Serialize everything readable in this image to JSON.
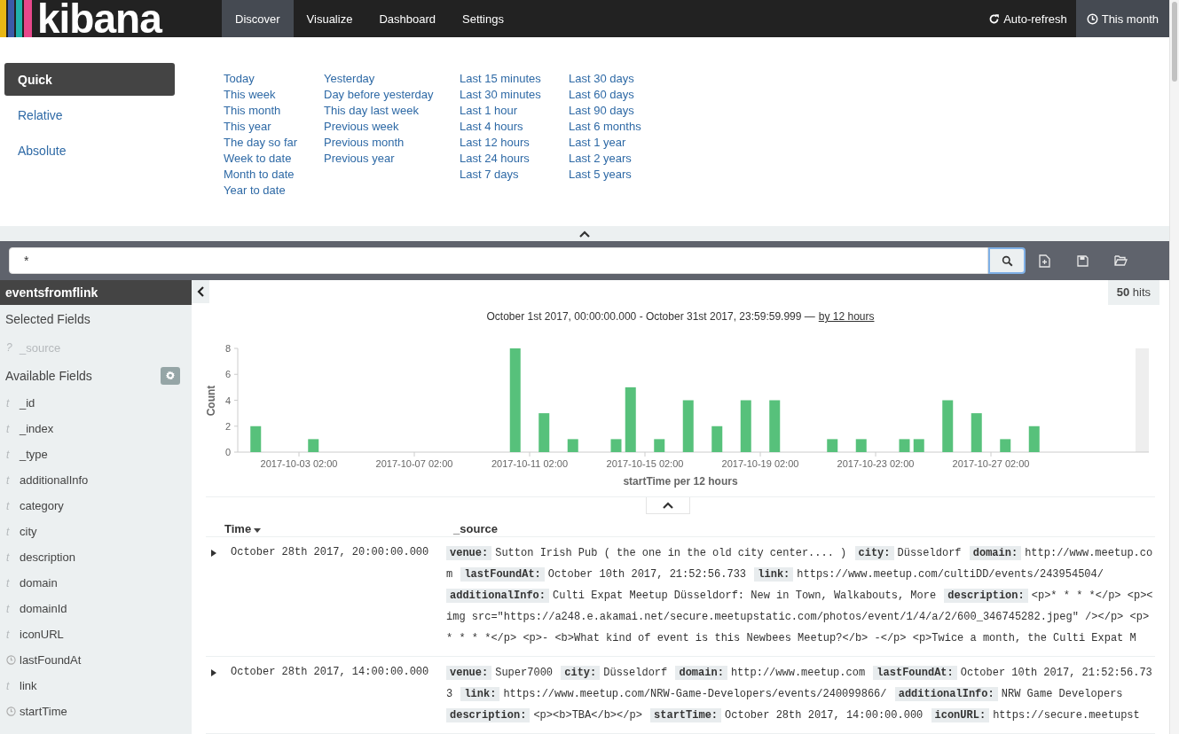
{
  "nav": {
    "logo": "kibana",
    "tabs": [
      {
        "label": "Discover",
        "selected": true
      },
      {
        "label": "Visualize",
        "selected": false
      },
      {
        "label": "Dashboard",
        "selected": false
      },
      {
        "label": "Settings",
        "selected": false
      }
    ],
    "auto_refresh": "Auto-refresh",
    "time_range": "This month"
  },
  "time_picker": {
    "modes": [
      {
        "label": "Quick",
        "selected": true
      },
      {
        "label": "Relative",
        "selected": false
      },
      {
        "label": "Absolute",
        "selected": false
      }
    ],
    "columns": [
      [
        "Today",
        "This week",
        "This month",
        "This year",
        "The day so far",
        "Week to date",
        "Month to date",
        "Year to date"
      ],
      [
        "Yesterday",
        "Day before yesterday",
        "This day last week",
        "Previous week",
        "Previous month",
        "Previous year"
      ],
      [
        "Last 15 minutes",
        "Last 30 minutes",
        "Last 1 hour",
        "Last 4 hours",
        "Last 12 hours",
        "Last 24 hours",
        "Last 7 days"
      ],
      [
        "Last 30 days",
        "Last 60 days",
        "Last 90 days",
        "Last 6 months",
        "Last 1 year",
        "Last 2 years",
        "Last 5 years"
      ]
    ]
  },
  "search": {
    "value": "*"
  },
  "sidebar": {
    "index_pattern": "eventsfromflink",
    "selected_heading": "Selected Fields",
    "selected_fields": [
      {
        "kind": "text",
        "icon": "?",
        "name": "_source"
      }
    ],
    "available_heading": "Available Fields",
    "available_fields": [
      {
        "kind": "text",
        "icon": "t",
        "name": "_id"
      },
      {
        "kind": "text",
        "icon": "t",
        "name": "_index"
      },
      {
        "kind": "text",
        "icon": "t",
        "name": "_type"
      },
      {
        "kind": "text",
        "icon": "t",
        "name": "additionalInfo"
      },
      {
        "kind": "text",
        "icon": "t",
        "name": "category"
      },
      {
        "kind": "text",
        "icon": "t",
        "name": "city"
      },
      {
        "kind": "text",
        "icon": "t",
        "name": "description"
      },
      {
        "kind": "text",
        "icon": "t",
        "name": "domain"
      },
      {
        "kind": "text",
        "icon": "t",
        "name": "domainId"
      },
      {
        "kind": "text",
        "icon": "t",
        "name": "iconURL"
      },
      {
        "kind": "date",
        "name": "lastFoundAt"
      },
      {
        "kind": "text",
        "icon": "t",
        "name": "link"
      },
      {
        "kind": "date",
        "name": "startTime"
      }
    ]
  },
  "main": {
    "hits": "**50** hits",
    "range": "October 1st 2017, 00:00:00.000 - October 31st 2017, 23:59:59.999 —",
    "interval_link": "by 12 hours",
    "chart_data": {
      "type": "bar",
      "xlabel": "startTime per 12 hours",
      "ylabel": "Count",
      "categories": [
        null,
        null,
        null,
        null,
        "2017-10-03 02:00",
        null,
        null,
        null,
        null,
        null,
        null,
        null,
        "2017-10-07 02:00",
        null,
        null,
        null,
        null,
        null,
        null,
        null,
        "2017-10-11 02:00",
        null,
        null,
        null,
        null,
        null,
        null,
        null,
        "2017-10-15 02:00",
        null,
        null,
        null,
        null,
        null,
        null,
        null,
        "2017-10-19 02:00",
        null,
        null,
        null,
        null,
        null,
        null,
        null,
        "2017-10-23 02:00",
        null,
        null,
        null,
        null,
        null,
        null,
        null,
        "2017-10-27 02:00",
        null,
        null,
        null,
        null,
        null,
        null,
        null,
        null,
        null
      ],
      "series": [
        {
          "color": "#57c17b",
          "values": [
            0,
            2,
            0,
            0,
            0,
            1,
            0,
            0,
            0,
            0,
            0,
            0,
            0,
            0,
            0,
            0,
            0,
            0,
            0,
            8,
            0,
            3,
            0,
            1,
            0,
            0,
            1,
            5,
            0,
            1,
            0,
            4,
            0,
            2,
            0,
            4,
            0,
            4,
            0,
            0,
            0,
            1,
            0,
            1,
            0,
            0,
            1,
            1,
            0,
            4,
            0,
            3,
            0,
            1,
            0,
            2,
            0,
            0,
            0,
            0,
            0,
            0
          ]
        }
      ],
      "ylim": [
        0,
        8
      ],
      "yticks": [
        0,
        2,
        4,
        6,
        8
      ]
    },
    "columns": [
      "Time",
      "_source"
    ],
    "rows": [
      {
        "time": "October 28th 2017, 20:00:00.000",
        "fields": [
          {
            "key": "venue:",
            "value": "Sutton Irish Pub ( the one in the old city center.... )"
          },
          {
            "key": "city:",
            "value": "Düsseldorf"
          },
          {
            "key": "domain:",
            "value": "http://www.meetup.com"
          },
          {
            "key": "lastFoundAt:",
            "value": "October 10th 2017, 21:52:56.733"
          },
          {
            "key": "link:",
            "value": "https://www.meetup.com/cultiDD/events/243954504/"
          },
          {
            "key": "additionalInfo:",
            "value": "Culti Expat Meetup Düsseldorf: New in Town, Walkabouts, More"
          },
          {
            "key": "description:",
            "value": "<p>* * * *</p> <p><img src=\"https://a248.e.akamai.net/secure.meetupstatic.com/photos/event/1/4/a/2/600_346745282.jpeg\" /></p> <p>* * * *</p> <p>- <b>What kind of event is this Newbees Meetup?</b> -</p> <p>Twice a month, the Culti Expat M"
          }
        ]
      },
      {
        "time": "October 28th 2017, 14:00:00.000",
        "fields": [
          {
            "key": "venue:",
            "value": "Super7000"
          },
          {
            "key": "city:",
            "value": "Düsseldorf"
          },
          {
            "key": "domain:",
            "value": "http://www.meetup.com"
          },
          {
            "key": "lastFoundAt:",
            "value": "October 10th 2017, 21:52:56.733"
          },
          {
            "key": "link:",
            "value": "https://www.meetup.com/NRW-Game-Developers/events/240099866/"
          },
          {
            "key": "additionalInfo:",
            "value": "NRW Game Developers"
          },
          {
            "key": "description:",
            "value": "<p><b>TBA</b></p>"
          },
          {
            "key": "startTime:",
            "value": "October 28th 2017, 14:00:00.000"
          },
          {
            "key": "iconURL:",
            "value": "https://secure.meetupst"
          }
        ]
      }
    ]
  }
}
